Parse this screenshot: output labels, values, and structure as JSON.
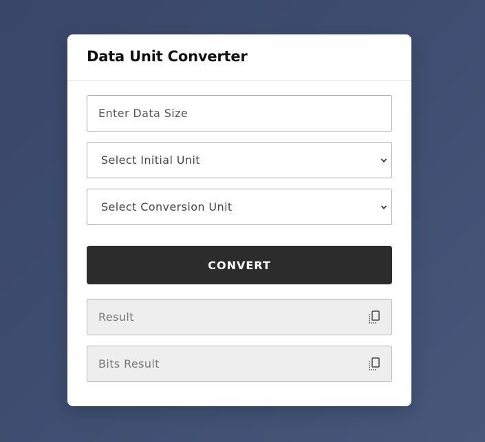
{
  "converter": {
    "title": "Data Unit Converter",
    "data_size_placeholder": "Enter Data Size",
    "initial_unit_selected": "Select Initial Unit",
    "conversion_unit_selected": "Select Conversion Unit",
    "convert_label": "CONVERT",
    "result_placeholder": "Result",
    "bits_result_placeholder": "Bits Result",
    "copy_icon": "copy-icon",
    "chevron_icon": "chevron-down-icon"
  },
  "colors": {
    "background": "#3d4a6d",
    "card": "#ffffff",
    "button": "#2c2c2c",
    "readonly_field": "#eeeeee"
  }
}
